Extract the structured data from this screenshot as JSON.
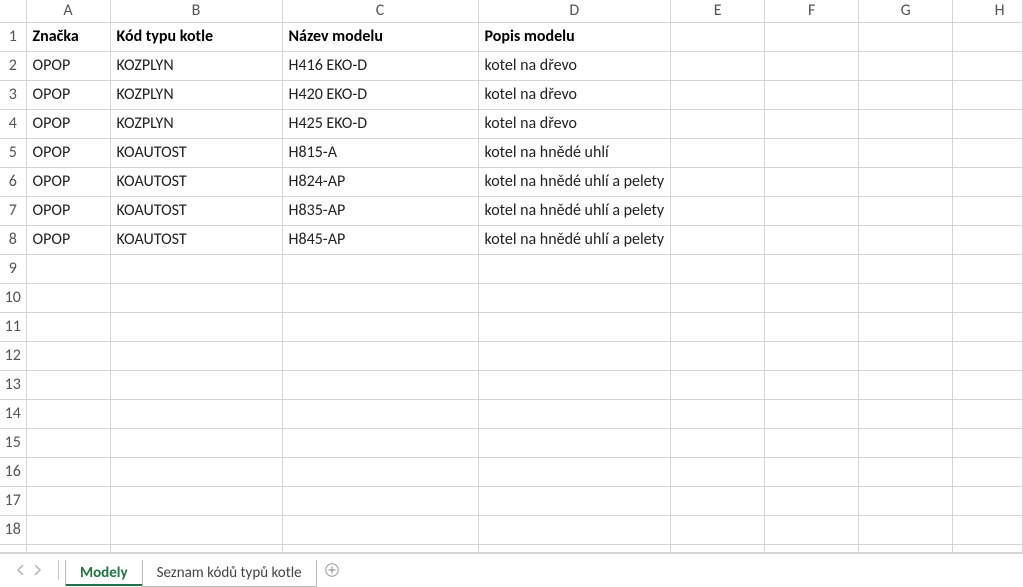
{
  "columns": [
    "A",
    "B",
    "C",
    "D",
    "E",
    "F",
    "G",
    "H"
  ],
  "row_count": 19,
  "headers": {
    "A": "Značka",
    "B": "Kód typu kotle",
    "C": "Název modelu",
    "D": "Popis modelu"
  },
  "rows": [
    {
      "A": "OPOP",
      "B": "KOZPLYN",
      "C": "H416 EKO-D",
      "D": "kotel na dřevo"
    },
    {
      "A": "OPOP",
      "B": "KOZPLYN",
      "C": "H420 EKO-D",
      "D": "kotel na dřevo"
    },
    {
      "A": "OPOP",
      "B": "KOZPLYN",
      "C": "H425 EKO-D",
      "D": "kotel na dřevo"
    },
    {
      "A": "OPOP",
      "B": "KOAUTOST",
      "C": "H815-A",
      "D": "kotel na hnědé uhlí"
    },
    {
      "A": "OPOP",
      "B": "KOAUTOST",
      "C": "H824-AP",
      "D": "kotel na hnědé uhlí a pelety"
    },
    {
      "A": "OPOP",
      "B": "KOAUTOST",
      "C": "H835-AP",
      "D": "kotel na hnědé uhlí a pelety"
    },
    {
      "A": "OPOP",
      "B": "KOAUTOST",
      "C": "H845-AP",
      "D": "kotel na hnědé uhlí a pelety"
    }
  ],
  "tabs": {
    "items": [
      {
        "label": "Modely",
        "active": true
      },
      {
        "label": "Seznam kódů typů kotle",
        "active": false
      }
    ]
  }
}
